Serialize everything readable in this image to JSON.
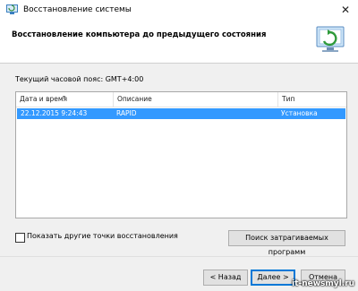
{
  "window": {
    "title": "Восстановление системы",
    "close_glyph": "✕"
  },
  "header": {
    "heading": "Восстановление компьютера до предыдущего состояния",
    "icon": "system-restore-icon"
  },
  "timezone": "Текущий часовой пояс: GMT+4:00",
  "table": {
    "columns": [
      "Дата и время",
      "Описание",
      "Тип"
    ],
    "rows": [
      {
        "date": "22.12.2015 9:24:43",
        "description": "RAPID",
        "type": "Установка",
        "selected": true
      }
    ]
  },
  "show_more": {
    "label": "Показать другие точки восстановления",
    "checked": false
  },
  "buttons": {
    "scan": "Поиск затрагиваемых программ",
    "back": "< Назад",
    "next": "Далее >",
    "cancel": "Отмена"
  },
  "watermark": "it-newsmyl.ru",
  "colors": {
    "selection": "#3399ff",
    "accent": "#0078d7"
  }
}
